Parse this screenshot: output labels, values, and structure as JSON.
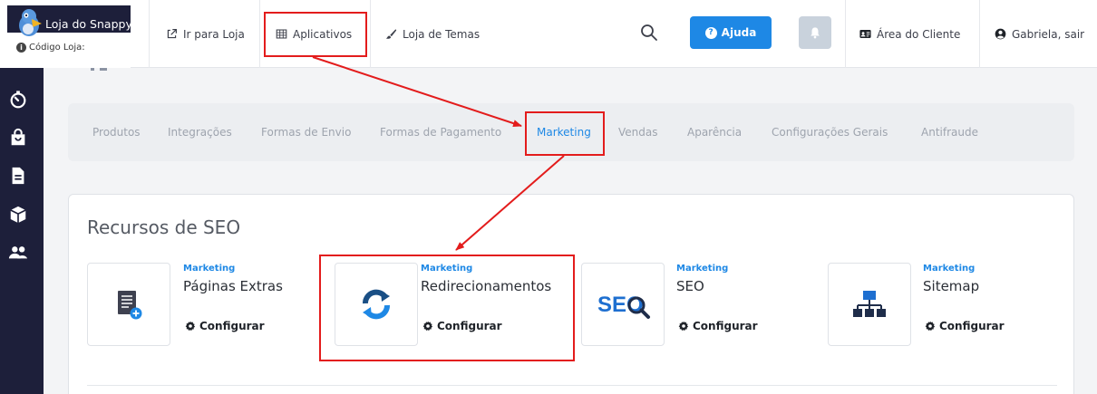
{
  "brand": {
    "name": "Loja do Snappy",
    "store_code_label": "Código Loja:"
  },
  "topbar": {
    "go_to_store": "Ir para Loja",
    "apps": "Aplicativos",
    "theme_store": "Loja de Temas",
    "help": "Ajuda",
    "client_area": "Área do Cliente",
    "user_logout": "Gabriela, sair"
  },
  "sidebar": {
    "items": [
      {
        "icon": "stopwatch-icon"
      },
      {
        "icon": "shopping-bag-icon"
      },
      {
        "icon": "document-icon"
      },
      {
        "icon": "box-icon"
      },
      {
        "icon": "users-icon"
      }
    ]
  },
  "tabs": [
    "Produtos",
    "Integrações",
    "Formas de Envio",
    "Formas de Pagamento",
    "Marketing",
    "Vendas",
    "Aparência",
    "Configurações Gerais",
    "Antifraude"
  ],
  "active_tab": "Marketing",
  "section": {
    "title": "Recursos de SEO"
  },
  "cards": [
    {
      "category": "Marketing",
      "title": "Páginas Extras",
      "action": "Configurar",
      "icon": "page-add-icon"
    },
    {
      "category": "Marketing",
      "title": "Redirecionamentos",
      "action": "Configurar",
      "icon": "refresh-icon"
    },
    {
      "category": "Marketing",
      "title": "SEO",
      "action": "Configurar",
      "icon": "seo-magnifier-icon",
      "icon_text": "SEO"
    },
    {
      "category": "Marketing",
      "title": "Sitemap",
      "action": "Configurar",
      "icon": "sitemap-icon"
    }
  ],
  "colors": {
    "accent": "#1e88e5",
    "sidebar": "#1d1f3a",
    "annotation": "#e31c1c"
  }
}
